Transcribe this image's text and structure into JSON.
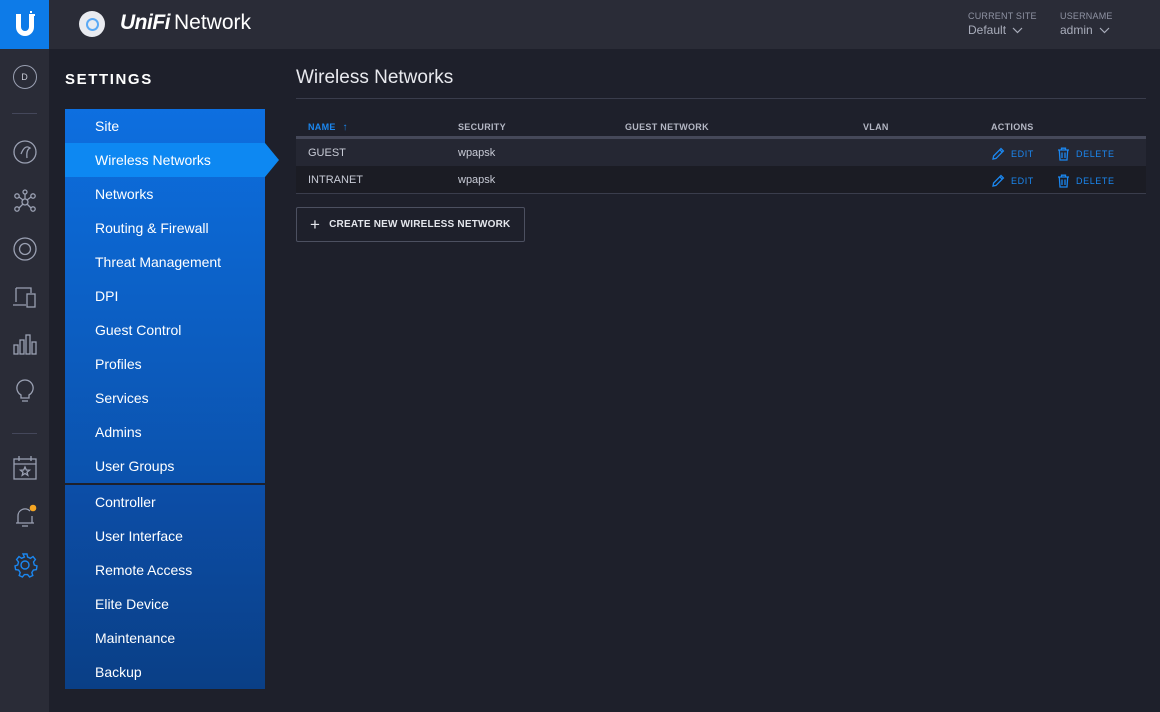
{
  "header": {
    "brand_unifi": "UniFi",
    "brand_network": "Network",
    "current_site_label": "CURRENT SITE",
    "current_site_value": "Default",
    "username_label": "USERNAME",
    "username_value": "admin"
  },
  "rail": {
    "dashboard_letter": "D",
    "icons": [
      "dashboard-icon",
      "map-icon",
      "topology-icon",
      "devices-icon",
      "clients-icon",
      "statistics-icon",
      "insights-icon",
      "events-icon",
      "alerts-icon",
      "settings-icon"
    ],
    "notification_color": "#f5a623"
  },
  "settings": {
    "title": "SETTINGS",
    "group1": [
      {
        "label": "Site"
      },
      {
        "label": "Wireless Networks",
        "active": true
      },
      {
        "label": "Networks"
      },
      {
        "label": "Routing & Firewall"
      },
      {
        "label": "Threat Management"
      },
      {
        "label": "DPI"
      },
      {
        "label": "Guest Control"
      },
      {
        "label": "Profiles"
      },
      {
        "label": "Services"
      },
      {
        "label": "Admins"
      },
      {
        "label": "User Groups"
      }
    ],
    "group2": [
      {
        "label": "Controller"
      },
      {
        "label": "User Interface"
      },
      {
        "label": "Remote Access"
      },
      {
        "label": "Elite Device"
      },
      {
        "label": "Maintenance"
      },
      {
        "label": "Backup"
      }
    ]
  },
  "main": {
    "title": "Wireless Networks",
    "columns": {
      "name": "NAME",
      "security": "SECURITY",
      "guest_network": "GUEST NETWORK",
      "vlan": "VLAN",
      "actions": "ACTIONS"
    },
    "sort_arrow": "↑",
    "rows": [
      {
        "name": "GUEST",
        "security": "wpapsk",
        "guest_network": "",
        "vlan": ""
      },
      {
        "name": "INTRANET",
        "security": "wpapsk",
        "guest_network": "",
        "vlan": ""
      }
    ],
    "edit_label": "EDIT",
    "delete_label": "DELETE",
    "create_button": "CREATE NEW WIRELESS NETWORK",
    "accent_color": "#1b87f0"
  }
}
